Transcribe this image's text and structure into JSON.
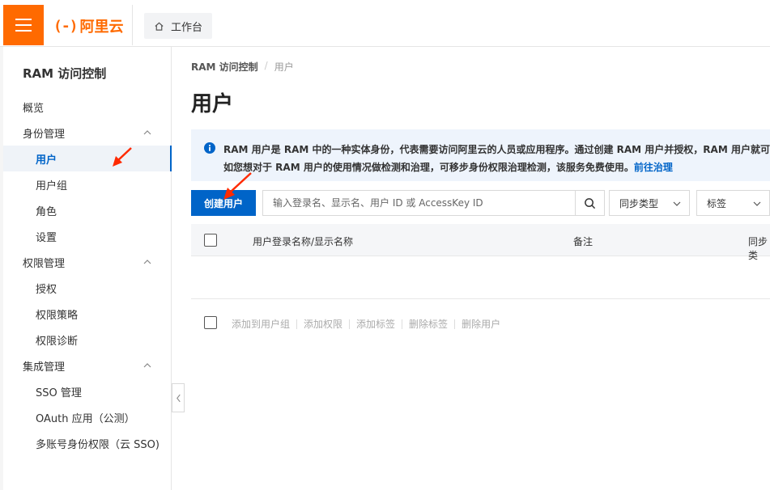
{
  "header": {
    "logo_mark": "(-)",
    "logo_text": "阿里云",
    "workbench_label": "工作台"
  },
  "sidebar": {
    "product_title": "RAM 访问控制",
    "items": [
      {
        "label": "概览",
        "level": 1
      },
      {
        "label": "身份管理",
        "level": 1,
        "group": true
      },
      {
        "label": "用户",
        "level": 2,
        "active": true
      },
      {
        "label": "用户组",
        "level": 2
      },
      {
        "label": "角色",
        "level": 2
      },
      {
        "label": "设置",
        "level": 2
      },
      {
        "label": "权限管理",
        "level": 1,
        "group": true
      },
      {
        "label": "授权",
        "level": 2
      },
      {
        "label": "权限策略",
        "level": 2
      },
      {
        "label": "权限诊断",
        "level": 2
      },
      {
        "label": "集成管理",
        "level": 1,
        "group": true
      },
      {
        "label": "SSO 管理",
        "level": 2
      },
      {
        "label": "OAuth 应用（公测）",
        "level": 2
      },
      {
        "label": "多账号身份权限（云 SSO)",
        "level": 2
      }
    ]
  },
  "main": {
    "breadcrumb": {
      "root": "RAM 访问控制",
      "separator": "/",
      "current": "用户"
    },
    "title": "用户",
    "notice": {
      "line1": "RAM 用户是 RAM 中的一种实体身份，代表需要访问阿里云的人员或应用程序。通过创建 RAM 用户并授权，RAM 用户就可以",
      "line2": "如您想对于 RAM 用户的使用情况做检测和治理，可移步身份权限治理检测，该服务免费使用。",
      "link": "前往治理"
    },
    "toolbar": {
      "create_label": "创建用户",
      "search_placeholder": "输入登录名、显示名、用户 ID 或 AccessKey ID",
      "filter1": "同步类型",
      "filter2": "标签"
    },
    "table": {
      "columns": [
        "用户登录名称/显示名称",
        "备注",
        "同步类"
      ]
    },
    "batch_actions": [
      "添加到用户组",
      "添加权限",
      "添加标签",
      "删除标签",
      "删除用户"
    ]
  },
  "colors": {
    "brand": "#ff6a00",
    "primary": "#0064c8",
    "annotation_arrow": "#ff2a00"
  }
}
